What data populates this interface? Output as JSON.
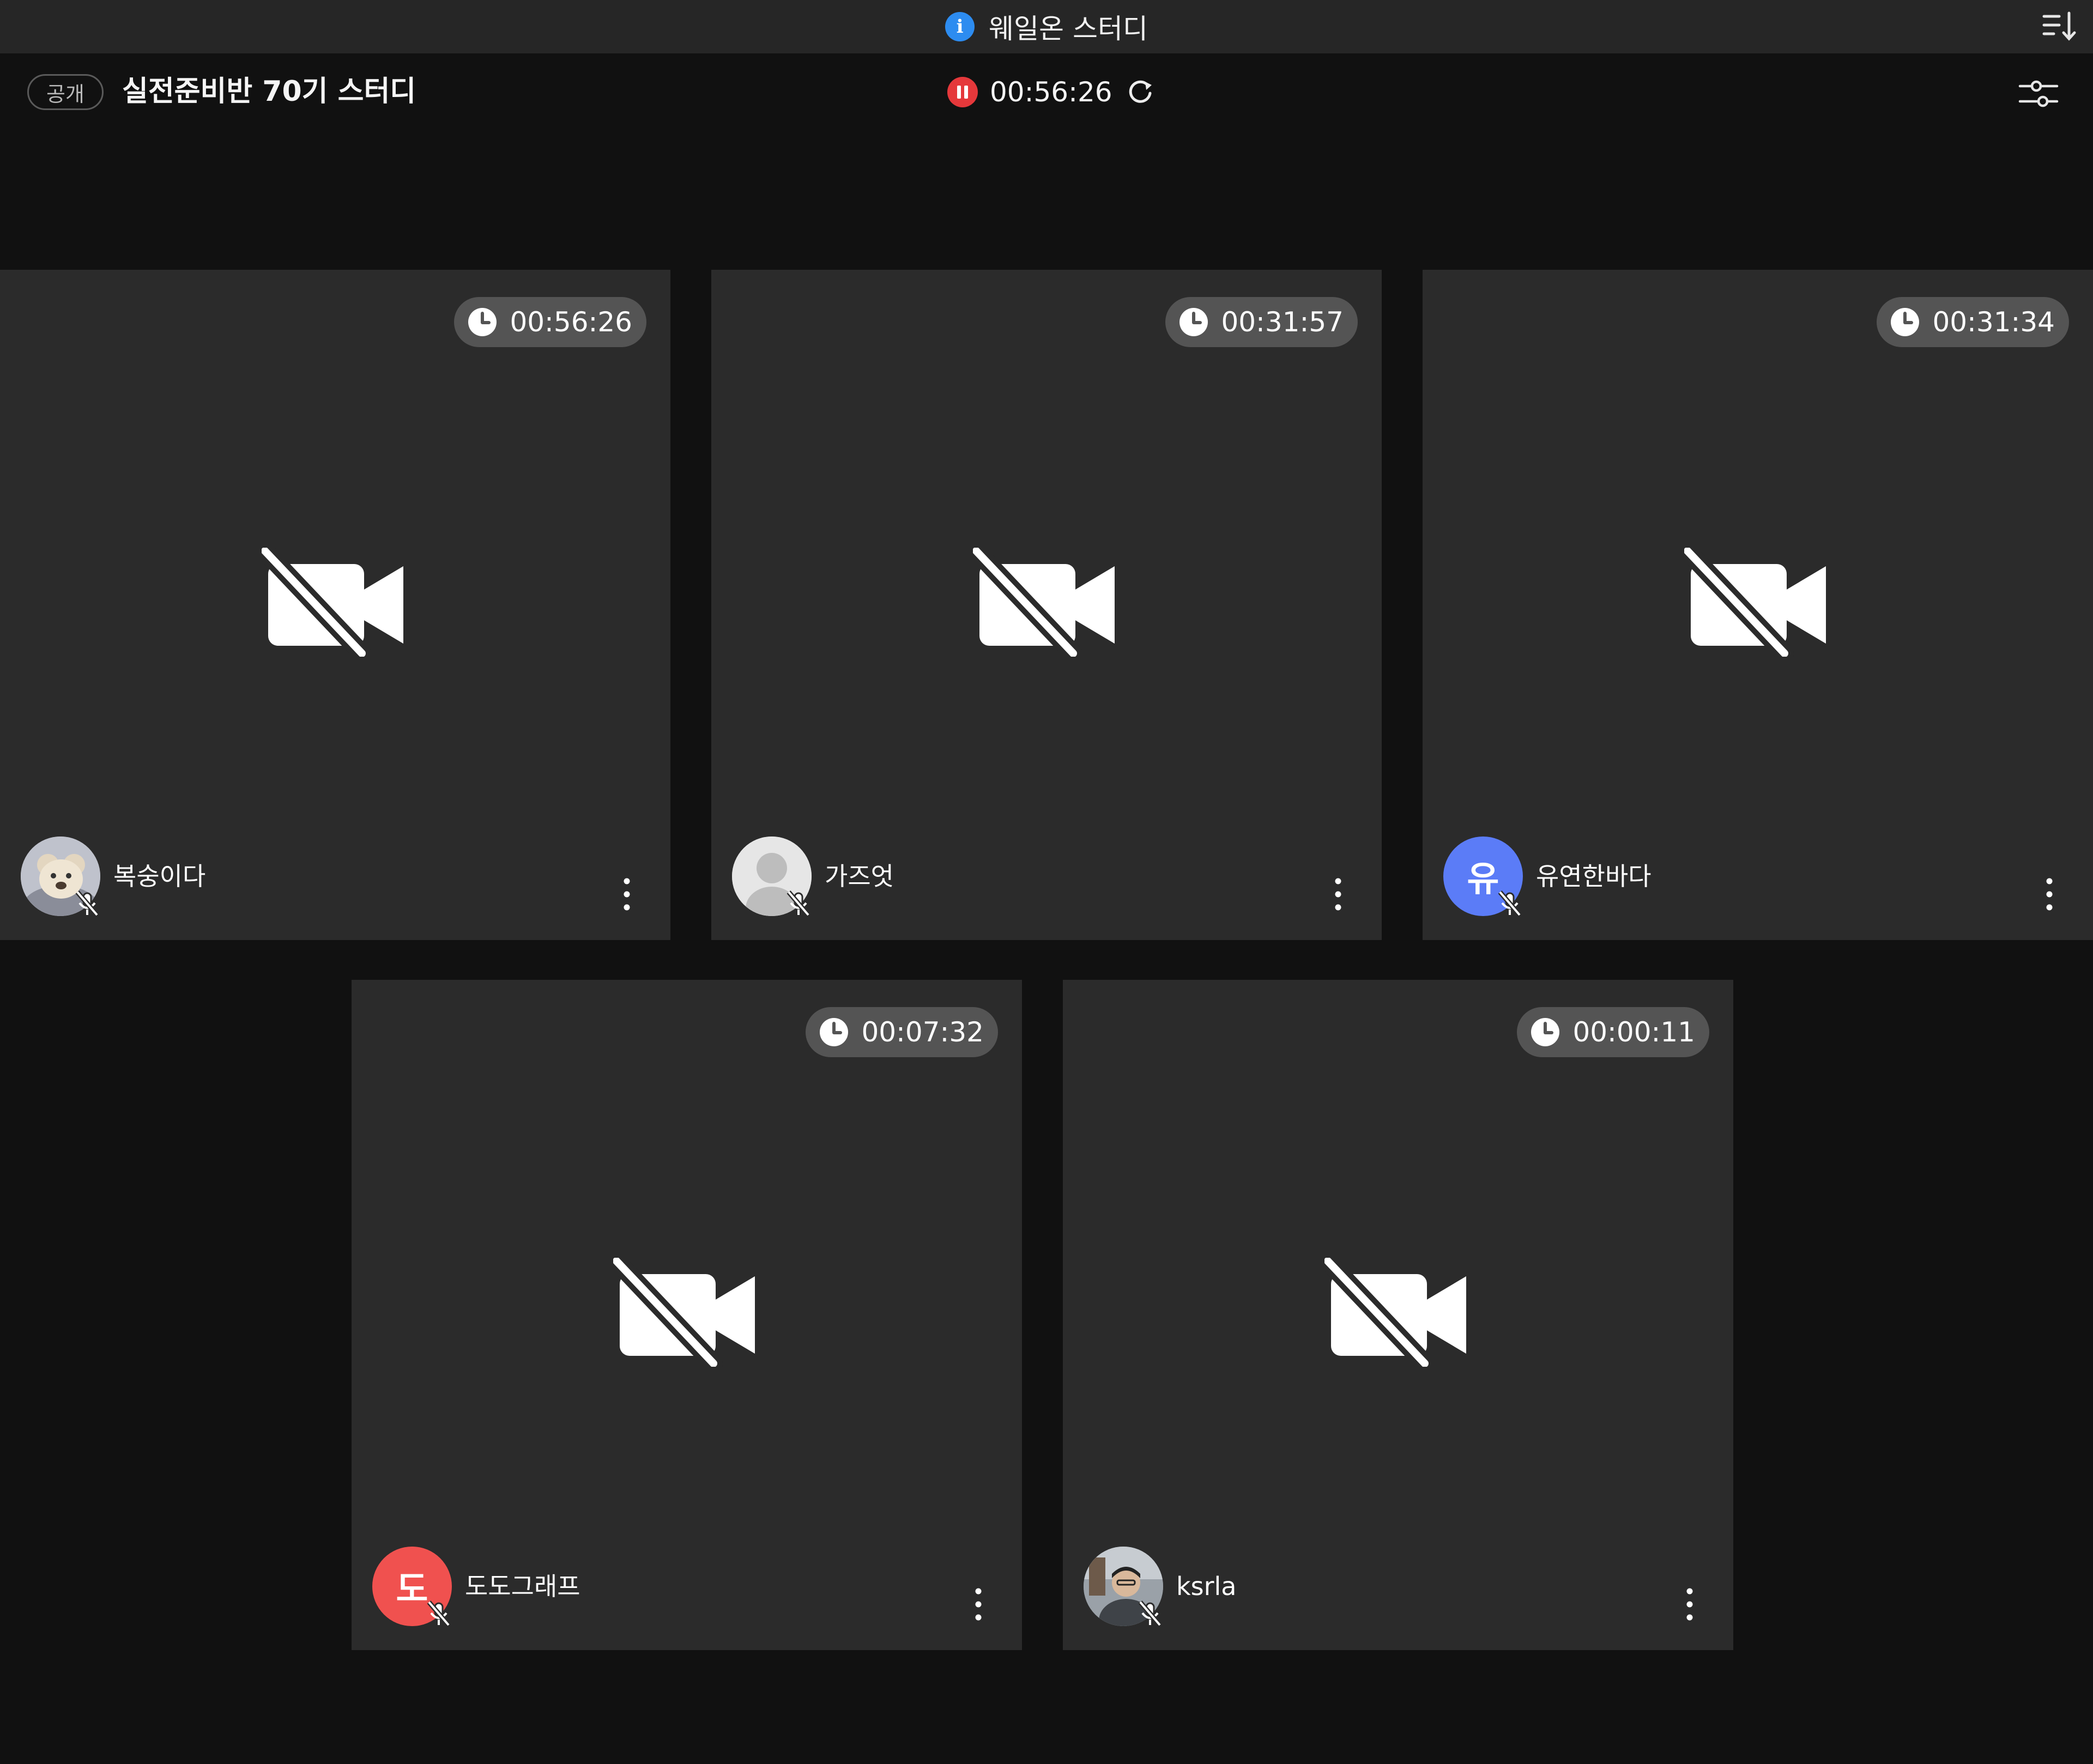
{
  "topbar": {
    "title": "웨일온 스터디",
    "info_icon": "info-icon",
    "sort_icon": "sort-descending-icon"
  },
  "header": {
    "visibility_badge": "공개",
    "room_title": "실전준비반 70기 스터디",
    "elapsed_time": "00:56:26",
    "rec_icon": "pause-recording-icon",
    "refresh_icon": "refresh-icon",
    "settings_icon": "sliders-settings-icon"
  },
  "colors": {
    "background": "#111111",
    "topbar": "#262626",
    "tile": "#2b2b2b",
    "timer_pill": "#545454",
    "record_red": "#e5383b",
    "info_blue": "#2d8cf0"
  },
  "participants": [
    {
      "name": "복숭이다",
      "timer": "00:56:26",
      "avatar": "photo-teddy-bear",
      "avatar_letter": ""
    },
    {
      "name": "가즈엇",
      "timer": "00:31:57",
      "avatar": "default-person",
      "avatar_letter": ""
    },
    {
      "name": "유연한바다",
      "timer": "00:31:34",
      "avatar": "letter",
      "avatar_letter": "유",
      "avatar_color": "#5b7cf7"
    },
    {
      "name": "도도그래프",
      "timer": "00:07:32",
      "avatar": "letter",
      "avatar_letter": "도",
      "avatar_color": "#f0514f"
    },
    {
      "name": "ksrla",
      "timer": "00:00:11",
      "avatar": "photo-person",
      "avatar_letter": ""
    }
  ]
}
